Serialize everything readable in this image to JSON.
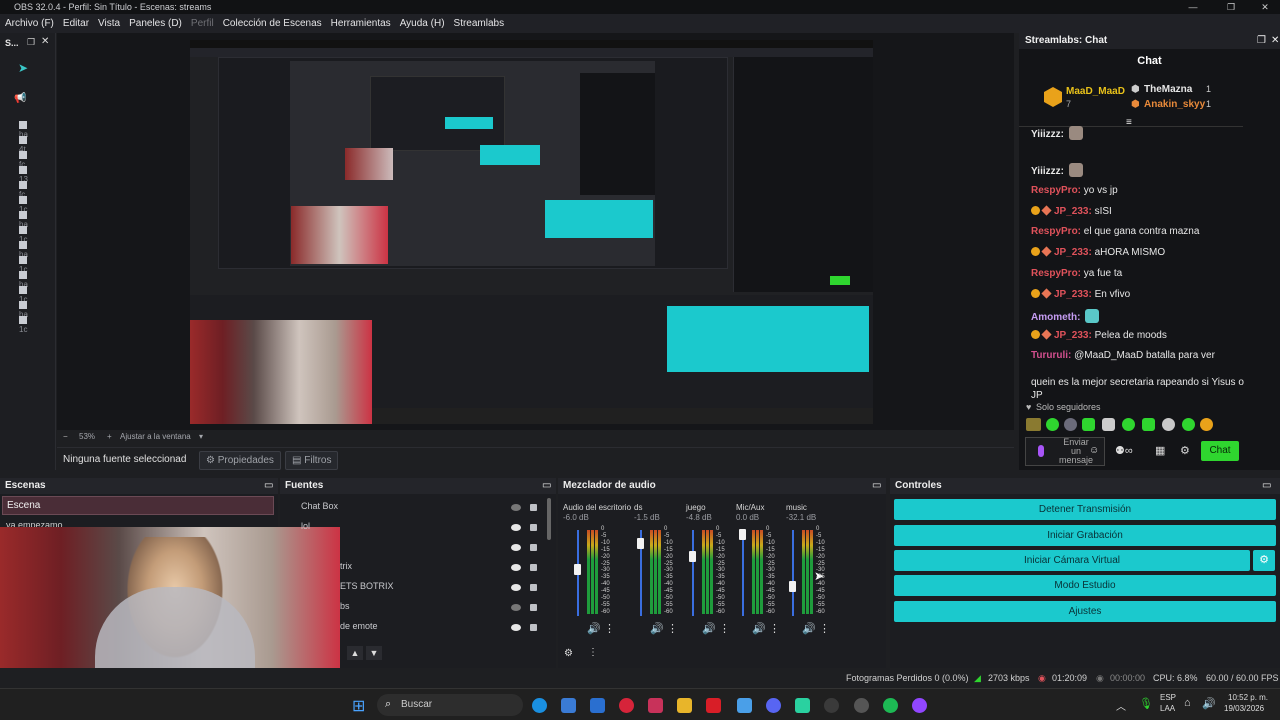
{
  "window": {
    "title": "OBS 32.0.4 - Perfil: Sin Título - Escenas: streams"
  },
  "menu": [
    "Archivo (F)",
    "Editar",
    "Vista",
    "Paneles (D)",
    "Perfil",
    "Colección de Escenas",
    "Herramientas",
    "Ayuda (H)",
    "Streamlabs"
  ],
  "left_dock": {
    "title": "S...",
    "rows": [
      "ha",
      "4t",
      "fc",
      "13",
      "fc",
      "1c",
      "ha",
      "1c",
      "ha",
      "1c",
      "ha",
      "1c",
      "ha",
      "1c"
    ]
  },
  "preview": {
    "zoom": "53%",
    "zoom_label": "Ajustar a la ventana"
  },
  "source_bar": {
    "status": "Ninguna fuente seleccionad",
    "properties": "Propiedades",
    "filters": "Filtros"
  },
  "chat": {
    "panel_title": "Streamlabs: Chat",
    "title": "Chat",
    "top1": {
      "name": "MaaD_MaaD",
      "count": "7"
    },
    "top2": {
      "name": "TheMazna",
      "count": "1"
    },
    "top3": {
      "name": "Anakin_skyy",
      "count": "1"
    },
    "messages": [
      {
        "user": "Yiiizzz:",
        "text": "",
        "color": "#e7e7e7"
      },
      {
        "user": "Yiiizzz:",
        "text": "",
        "color": "#e7e7e7"
      },
      {
        "user": "RespyPro:",
        "text": " yo vs jp",
        "color": "#e0525b"
      },
      {
        "user": "JP_233:",
        "text": " sISI",
        "color": "#e0525b"
      },
      {
        "user": "RespyPro:",
        "text": " el que gana contra mazna",
        "color": "#e0525b"
      },
      {
        "user": "JP_233:",
        "text": " aHORA MISMO",
        "color": "#e0525b"
      },
      {
        "user": "RespyPro:",
        "text": " ya fue ta",
        "color": "#e0525b"
      },
      {
        "user": "JP_233:",
        "text": " En vfivo",
        "color": "#e0525b"
      },
      {
        "user": "Amometh:",
        "text": "",
        "color": "#c59cf2"
      },
      {
        "user": "JP_233:",
        "text": " Pelea de moods",
        "color": "#e0525b"
      },
      {
        "user": "Tururuli:",
        "text": " @MaaD_MaaD batalla para ver",
        "color": "#d24f8e"
      }
    ],
    "wrap1": "quein es la mejor secretaria rapeando si Yisus o",
    "wrap2": "JP",
    "followers": "Solo seguidores",
    "send_placeholder": "Enviar un mensaje",
    "send_button": "Chat"
  },
  "scenes": {
    "title": "Escenas",
    "items": [
      "Escena",
      "ya empezamo"
    ]
  },
  "sources": {
    "title": "Fuentes",
    "items": [
      "Chat Box",
      "lol",
      "",
      "trix",
      "ETS BOTRIX",
      "bs",
      "de emote"
    ]
  },
  "mixer": {
    "title": "Mezclador de audio",
    "channels": [
      {
        "name": "Audio del escritorio",
        "db": "-6.0 dB",
        "level": 0.55
      },
      {
        "name": "ds",
        "db": "-1.5 dB",
        "level": 0.85
      },
      {
        "name": "juego",
        "db": "-4.8 dB",
        "level": 0.7
      },
      {
        "name": "Mic/Aux",
        "db": "0.0 dB",
        "level": 0.95
      },
      {
        "name": "music",
        "db": "-32.1 dB",
        "level": 0.35
      }
    ],
    "scale": [
      "0",
      "-5",
      "-10",
      "-15",
      "-20",
      "-25",
      "-30",
      "-35",
      "-40",
      "-45",
      "-50",
      "-55",
      "-60"
    ]
  },
  "controls": {
    "title": "Controles",
    "buttons": [
      "Detener Transmisión",
      "Iniciar Grabación",
      "Iniciar Cámara Virtual",
      "Modo Estudio",
      "Ajustes"
    ]
  },
  "status": {
    "dropped": "Fotogramas Perdidos 0 (0.0%)",
    "bitrate": "2703 kbps",
    "stream_time": "01:20:09",
    "rec_time": "00:00:00",
    "cpu": "CPU: 6.8%",
    "fps": "60.00 / 60.00 FPS"
  },
  "taskbar": {
    "search": "Buscar",
    "lang1": "ESP",
    "lang2": "LAA",
    "time": "10:52 p. m.",
    "date": "19/03/2026"
  },
  "colors": {
    "accent": "#1bc9cd",
    "chat_green": "#2fd62f",
    "live_red": "#e0525b"
  }
}
